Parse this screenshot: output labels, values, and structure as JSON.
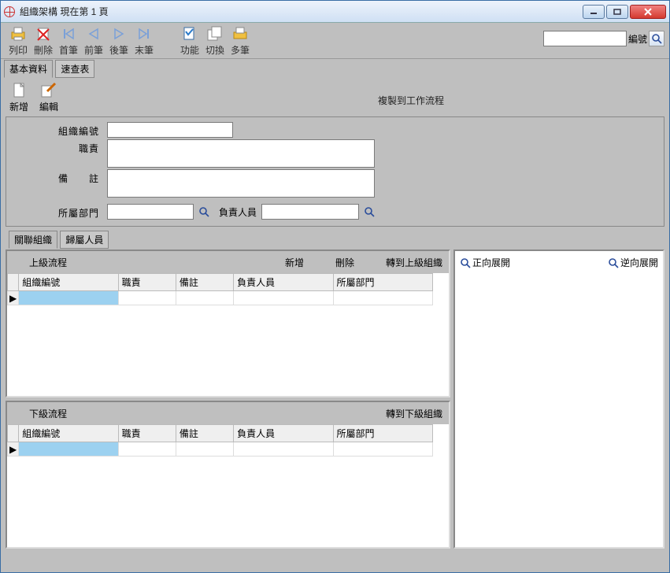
{
  "window_title": "組織架構  現在第 1 頁",
  "toolbar": {
    "print": "列印",
    "delete": "刪除",
    "first": "首筆",
    "prev": "前筆",
    "next": "後筆",
    "last": "末筆",
    "func": "功能",
    "switch": "切換",
    "multi": "多筆",
    "search_label": "編號"
  },
  "tabs1": {
    "basic": "基本資料",
    "quick": "速查表"
  },
  "mini": {
    "new": "新增",
    "edit": "編輯"
  },
  "copy_link": "複製到工作流程",
  "form": {
    "org_no_label": "組織編號",
    "duty_label": "職責",
    "remark_label": "備　　註",
    "dept_label": "所屬部門",
    "person_label": "負責人員",
    "org_no": "",
    "duty": "",
    "remark": "",
    "dept": "",
    "person": ""
  },
  "tabs2": {
    "related": "關聯組織",
    "members": "歸屬人員"
  },
  "upper": {
    "title": "上級流程",
    "add": "新增",
    "del": "刪除",
    "goto": "轉到上級組織",
    "cols": {
      "no": "組織編號",
      "duty": "職責",
      "remark": "備註",
      "person": "負責人員",
      "dept": "所屬部門"
    }
  },
  "lower": {
    "title": "下級流程",
    "goto": "轉到下級組織",
    "cols": {
      "no": "組織編號",
      "duty": "職責",
      "remark": "備註",
      "person": "負責人員",
      "dept": "所屬部門"
    }
  },
  "tree": {
    "fwd": "正向展開",
    "rev": "逆向展開"
  }
}
